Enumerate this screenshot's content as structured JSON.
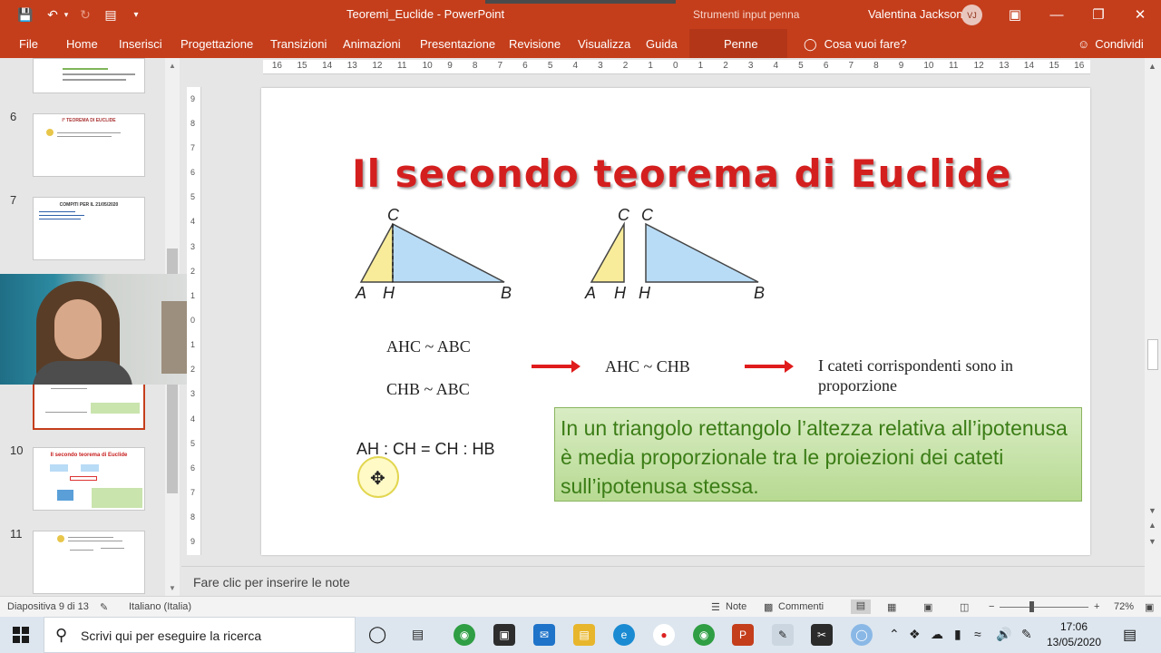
{
  "window": {
    "title": "Teoremi_Euclide  -  PowerPoint",
    "context_label": "Strumenti input penna",
    "user_name": "Valentina Jackson",
    "user_initials": "VJ"
  },
  "ribbon": {
    "tabs": [
      "File",
      "Home",
      "Inserisci",
      "Progettazione",
      "Transizioni",
      "Animazioni",
      "Presentazione",
      "Revisione",
      "Visualizza",
      "Guida",
      "Penne"
    ],
    "tell_me": "Cosa vuoi fare?",
    "share": "Condividi"
  },
  "thumbnails": {
    "numbers": [
      "6",
      "7",
      "10",
      "11"
    ],
    "slide6_title": "I° TEOREMA DI EUCLIDE",
    "slide7_title": "COMPITI PER IL 21/05/2020",
    "slide10_title": "Il secondo teorema di Euclide"
  },
  "ruler": {
    "h_ticks": [
      "16",
      "15",
      "14",
      "13",
      "12",
      "11",
      "10",
      "9",
      "8",
      "7",
      "6",
      "5",
      "4",
      "3",
      "2",
      "1",
      "0",
      "1",
      "2",
      "3",
      "4",
      "5",
      "6",
      "7",
      "8",
      "9",
      "10",
      "11",
      "12",
      "13",
      "14",
      "15",
      "16"
    ],
    "v_ticks": [
      "9",
      "8",
      "7",
      "6",
      "5",
      "4",
      "3",
      "2",
      "1",
      "0",
      "1",
      "2",
      "3",
      "4",
      "5",
      "6",
      "7",
      "8",
      "9"
    ]
  },
  "slide": {
    "title": "Il secondo teorema di Euclide",
    "fig1": {
      "c": "C",
      "a": "A",
      "h": "H",
      "b": "B"
    },
    "fig2": {
      "c1": "C",
      "c2": "C",
      "a": "A",
      "h1": "H",
      "h2": "H",
      "b": "B"
    },
    "eq1": "AHC ~ ABC",
    "eq2": "CHB ~ ABC",
    "eq3": "AHC ~ CHB",
    "conclusion": "I cateti corrispondenti sono in proporzione",
    "proportion": "AH : CH = CH : HB",
    "theorem": "In un triangolo rettangolo l’altezza relativa all’ipotenusa è media proporzionale tra le proiezioni dei cateti sull’ipotenusa stessa."
  },
  "notes_placeholder": "Fare clic per inserire le note",
  "status": {
    "slide_info": "Diapositiva 9 di 13",
    "language": "Italiano (Italia)",
    "notes": "Note",
    "comments": "Commenti",
    "zoom": "72%"
  },
  "taskbar": {
    "search_placeholder": "Scrivi qui per eseguire la ricerca",
    "time": "17:06",
    "date": "13/05/2020"
  },
  "colors": {
    "accent": "#c43e1c",
    "title_red": "#d41f1f",
    "theorem_green": "#3b7d16",
    "triangle_yellow": "#f8ec9a",
    "triangle_blue": "#b9dcf6"
  }
}
